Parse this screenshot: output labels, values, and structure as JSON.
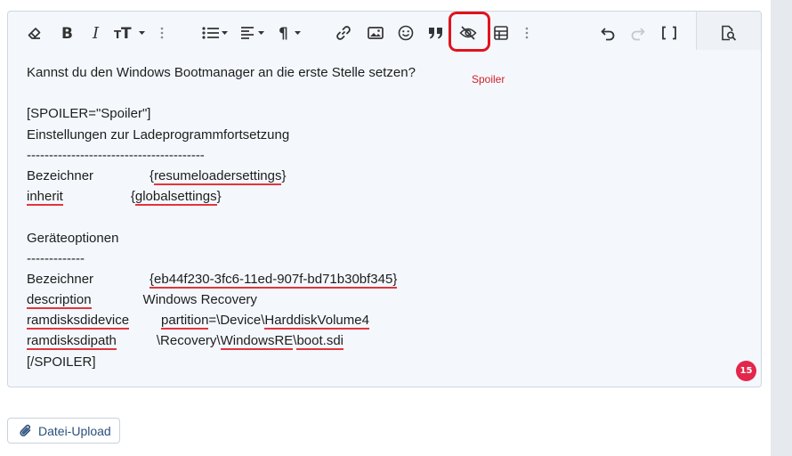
{
  "annotation": "Spoiler",
  "badge_count": "15",
  "upload_label": "Datei-Upload",
  "toolbar": {
    "items": [
      "eraser-icon",
      "bold-icon",
      "italic-icon",
      "text-size-icon",
      "more-icon",
      "list-icon",
      "align-icon",
      "paragraph-icon",
      "link-icon",
      "image-icon",
      "smiley-icon",
      "quote-icon",
      "spoiler-icon",
      "table-icon",
      "more-icon",
      "undo-icon",
      "redo-icon",
      "bbcode-icon",
      "preview-icon"
    ]
  },
  "content": {
    "line1": "Kannst du den Windows Bootmanager an die erste Stelle setzen?",
    "spoiler_open": "[SPOILER=\"Spoiler\"]",
    "heading1": "Einstellungen zur Ladeprogrammfortsetzung",
    "dashes1": "----------------------------------------",
    "r1_key": "Bezeichner",
    "r1_val_a": "{",
    "r1_val_b": "resumeloadersettings",
    "r1_val_c": "}",
    "r2_key": "inherit",
    "r2_val_a": "{",
    "r2_val_b": "globalsettings",
    "r2_val_c": "}",
    "heading2": "Geräteoptionen",
    "dashes2": "-------------",
    "r3_key": "Bezeichner",
    "r3_val": "{eb44f230-3fc6-11ed-907f-bd71b30bf345}",
    "r4_key": "description",
    "r4_val": "Windows Recovery",
    "r5_key": "ramdisksdidevice",
    "r5_val_a": "partition",
    "r5_val_b": "=\\Device\\",
    "r5_val_c": "HarddiskVolume4",
    "r6_key": "ramdisksdipath",
    "r6_val_a": "\\Recovery\\",
    "r6_val_b": "WindowsRE",
    "r6_val_c": "\\",
    "r6_val_d": "boot.sdi",
    "spoiler_close": "[/SPOILER]"
  }
}
